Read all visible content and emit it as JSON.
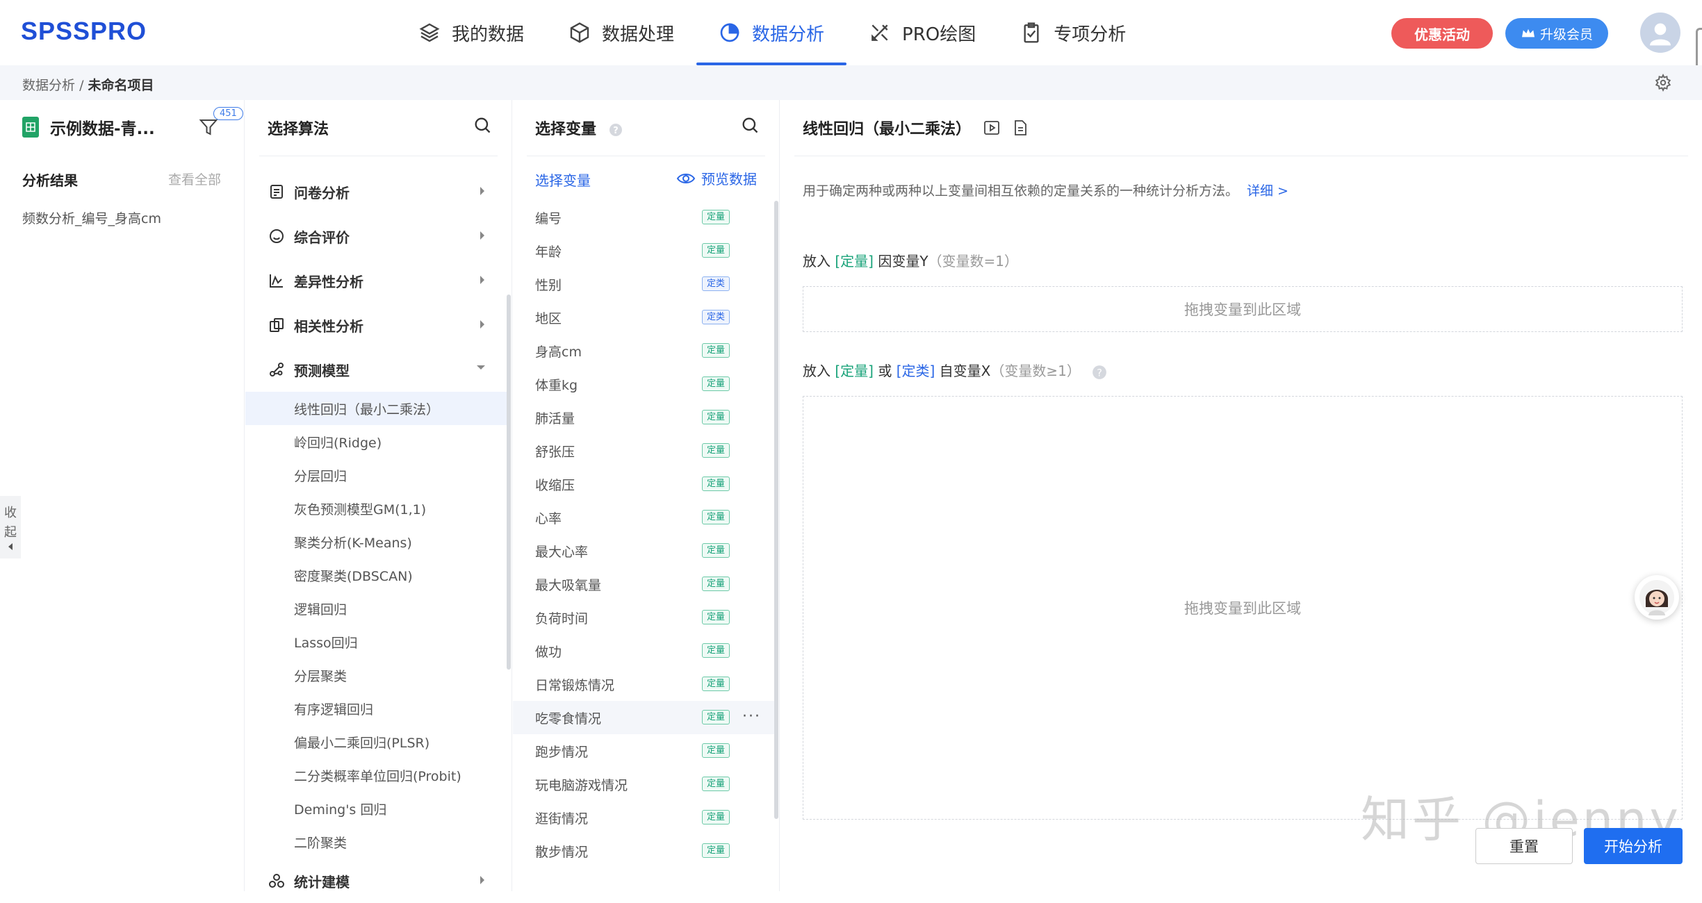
{
  "app": {
    "logo": "SPSSPRO"
  },
  "nav": {
    "items": [
      {
        "label": "我的数据",
        "icon": "layers-icon"
      },
      {
        "label": "数据处理",
        "icon": "cube-icon"
      },
      {
        "label": "数据分析",
        "icon": "pie-chart-icon",
        "active": true
      },
      {
        "label": "PRO绘图",
        "icon": "draw-tools-icon"
      },
      {
        "label": "专项分析",
        "icon": "clipboard-icon"
      }
    ],
    "promo_label": "优惠活动",
    "vip_label": "升级会员"
  },
  "breadcrumb": {
    "parent": "数据分析",
    "separator": "/",
    "current": "未命名项目"
  },
  "left_panel": {
    "dataset_name": "示例数据-青...",
    "filter_badge": "451",
    "results_title": "分析结果",
    "results_view_all": "查看全部",
    "results": [
      "频数分析_编号_身高cm"
    ],
    "collapse_label_1": "收",
    "collapse_label_2": "起"
  },
  "algorithm_panel": {
    "title": "选择算法",
    "categories": [
      {
        "label": "问卷分析",
        "icon": "survey-icon",
        "expanded": false
      },
      {
        "label": "综合评价",
        "icon": "smile-icon",
        "expanded": false
      },
      {
        "label": "差异性分析",
        "icon": "trend-icon",
        "expanded": false
      },
      {
        "label": "相关性分析",
        "icon": "correlation-icon",
        "expanded": false
      },
      {
        "label": "预测模型",
        "icon": "model-icon",
        "expanded": true
      }
    ],
    "models": [
      "线性回归（最小二乘法）",
      "岭回归(Ridge)",
      "分层回归",
      "灰色预测模型GM(1,1)",
      "聚类分析(K-Means)",
      "密度聚类(DBSCAN)",
      "逻辑回归",
      "Lasso回归",
      "分层聚类",
      "有序逻辑回归",
      "偏最小二乘回归(PLSR)",
      "二分类概率单位回归(Probit)",
      "Deming's 回归",
      "二阶聚类"
    ],
    "last_category": {
      "label": "统计建模",
      "icon": "stat-modeling-icon"
    }
  },
  "variable_panel": {
    "title": "选择变量",
    "subheader": "选择变量",
    "preview_label": "预览数据",
    "variables": [
      {
        "name": "编号",
        "type": "定量",
        "kind": "q"
      },
      {
        "name": "年龄",
        "type": "定量",
        "kind": "q"
      },
      {
        "name": "性别",
        "type": "定类",
        "kind": "c"
      },
      {
        "name": "地区",
        "type": "定类",
        "kind": "c"
      },
      {
        "name": "身高cm",
        "type": "定量",
        "kind": "q"
      },
      {
        "name": "体重kg",
        "type": "定量",
        "kind": "q"
      },
      {
        "name": "肺活量",
        "type": "定量",
        "kind": "q"
      },
      {
        "name": "舒张压",
        "type": "定量",
        "kind": "q"
      },
      {
        "name": "收缩压",
        "type": "定量",
        "kind": "q"
      },
      {
        "name": "心率",
        "type": "定量",
        "kind": "q"
      },
      {
        "name": "最大心率",
        "type": "定量",
        "kind": "q"
      },
      {
        "name": "最大吸氧量",
        "type": "定量",
        "kind": "q"
      },
      {
        "name": "负荷时间",
        "type": "定量",
        "kind": "q"
      },
      {
        "name": "做功",
        "type": "定量",
        "kind": "q"
      },
      {
        "name": "日常锻炼情况",
        "type": "定量",
        "kind": "q"
      },
      {
        "name": "吃零食情况",
        "type": "定量",
        "kind": "q"
      },
      {
        "name": "跑步情况",
        "type": "定量",
        "kind": "q"
      },
      {
        "name": "玩电脑游戏情况",
        "type": "定量",
        "kind": "q"
      },
      {
        "name": "逛街情况",
        "type": "定量",
        "kind": "q"
      },
      {
        "name": "散步情况",
        "type": "定量",
        "kind": "q"
      }
    ],
    "more_label": "···"
  },
  "method_panel": {
    "title": "线性回归（最小二乘法）",
    "description": "用于确定两种或两种以上变量间相互依赖的定量关系的一种统计分析方法。",
    "detail_link": "详细 >",
    "y_zone": {
      "prefix": "放入",
      "tag1": "[定量]",
      "label": "因变量Y",
      "count": "（变量数=1）",
      "placeholder": "拖拽变量到此区域"
    },
    "x_zone": {
      "prefix": "放入",
      "tag1": "[定量]",
      "or": "或",
      "tag2": "[定类]",
      "label": "自变量X",
      "count": "（变量数≥1）",
      "placeholder": "拖拽变量到此区域"
    },
    "reset_label": "重置",
    "start_label": "开始分析"
  },
  "watermark": "知乎 @jenny",
  "colors": {
    "accent": "#2a66e6",
    "quant_tag": "#1aa37a",
    "promo": "#ee5a5a",
    "primary_button": "#1f6ef0"
  }
}
